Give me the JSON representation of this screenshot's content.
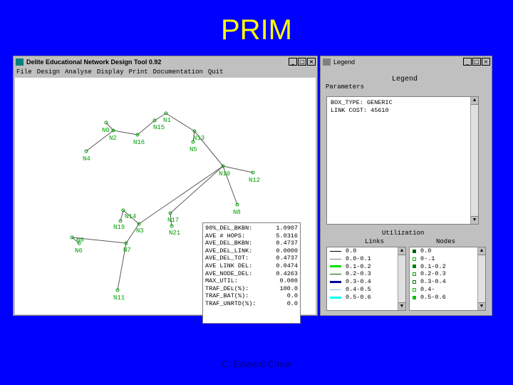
{
  "slide": {
    "title": "PRIM",
    "footer": "C. Edward Chow"
  },
  "main_window": {
    "title": "Delite Educational Network Design Tool 0.92",
    "menu": [
      "File",
      "Design",
      "Analyse",
      "Display",
      "Print",
      "Documentation",
      "Quit"
    ],
    "controls": [
      "_",
      "□",
      "×"
    ]
  },
  "network": {
    "link_color": "#5a5a5a",
    "node_color": "#00a000",
    "nodes": [
      {
        "id": "n1",
        "label": "N1"
      },
      {
        "id": "n15",
        "label": "N15"
      },
      {
        "id": "n0",
        "label": "N0"
      },
      {
        "id": "n2",
        "label": "N2"
      },
      {
        "id": "n16",
        "label": "N16"
      },
      {
        "id": "n13",
        "label": "N13"
      },
      {
        "id": "n5",
        "label": "N5"
      },
      {
        "id": "n4",
        "label": "N4"
      },
      {
        "id": "n10",
        "label": "N10"
      },
      {
        "id": "n12",
        "label": "N12"
      },
      {
        "id": "n8",
        "label": "N8"
      },
      {
        "id": "n14",
        "label": "N14"
      },
      {
        "id": "n17",
        "label": "N17"
      },
      {
        "id": "n19",
        "label": "N19"
      },
      {
        "id": "n3",
        "label": "N3"
      },
      {
        "id": "n21",
        "label": "N21"
      },
      {
        "id": "n0b",
        "label": "N0"
      },
      {
        "id": "n6",
        "label": "N6"
      },
      {
        "id": "n7",
        "label": "N7"
      },
      {
        "id": "n11",
        "label": "N11"
      }
    ]
  },
  "stats": [
    {
      "label": "90%_DEL_BKBN:",
      "value": "1.0907"
    },
    {
      "label": "AVE # HOPS:",
      "value": "5.0316"
    },
    {
      "label": "AVE_DEL_BKBN:",
      "value": "0.4737"
    },
    {
      "label": "AVE_DEL_LINK:",
      "value": "0.0000"
    },
    {
      "label": "AVE_DEL_TOT:",
      "value": "0.4737"
    },
    {
      "label": "AVE LINK DEL:",
      "value": "0.0474"
    },
    {
      "label": "AVE_NODE_DEL:",
      "value": "0.4263"
    },
    {
      "label": "MAX_UTIL:",
      "value": "0.000"
    },
    {
      "label": "TRAF_DEL(%):",
      "value": "100.0"
    },
    {
      "label": "TRAF_BAT(%):",
      "value": "0.0"
    },
    {
      "label": "TRAF_UNRTD(%):",
      "value": "0.0"
    }
  ],
  "legend_window": {
    "title": "Legend",
    "controls": [
      "_",
      "□",
      "×"
    ],
    "heading": "Legend",
    "parameters_label": "Parameters",
    "parameters": [
      "BOX_TYPE: GENERIC",
      "LINK COST: 45610"
    ],
    "utilization_label": "Utilization",
    "links_label": "Links",
    "nodes_label": "Nodes",
    "links": [
      {
        "range": "0.0",
        "color": "#000000",
        "width": 1
      },
      {
        "range": "0.0-0.1",
        "color": "#808080",
        "width": 1
      },
      {
        "range": "0.1-0.2",
        "color": "#00e000",
        "width": 3
      },
      {
        "range": "0.2-0.3",
        "color": "#006000",
        "width": 1
      },
      {
        "range": "0.3-0.4",
        "color": "#0000a0",
        "width": 3
      },
      {
        "range": "0.4-0.5",
        "color": "#80c0ff",
        "width": 1
      },
      {
        "range": "0.5-0.6",
        "color": "#00ffff",
        "width": 3
      }
    ],
    "nodes": [
      {
        "range": "0.0",
        "color": "#006000",
        "filled": true
      },
      {
        "range": "0-.1",
        "color": "#00c000",
        "filled": false
      },
      {
        "range": "0.1-0.2",
        "color": "#008000",
        "filled": true
      },
      {
        "range": "0.2-0.3",
        "color": "#00a000",
        "filled": false
      },
      {
        "range": "0.3-0.4",
        "color": "#008000",
        "filled": false
      },
      {
        "range": "0.4-",
        "color": "#00c000",
        "filled": false
      },
      {
        "range": "0.5-0.6",
        "color": "#00c000",
        "filled": true
      }
    ]
  }
}
